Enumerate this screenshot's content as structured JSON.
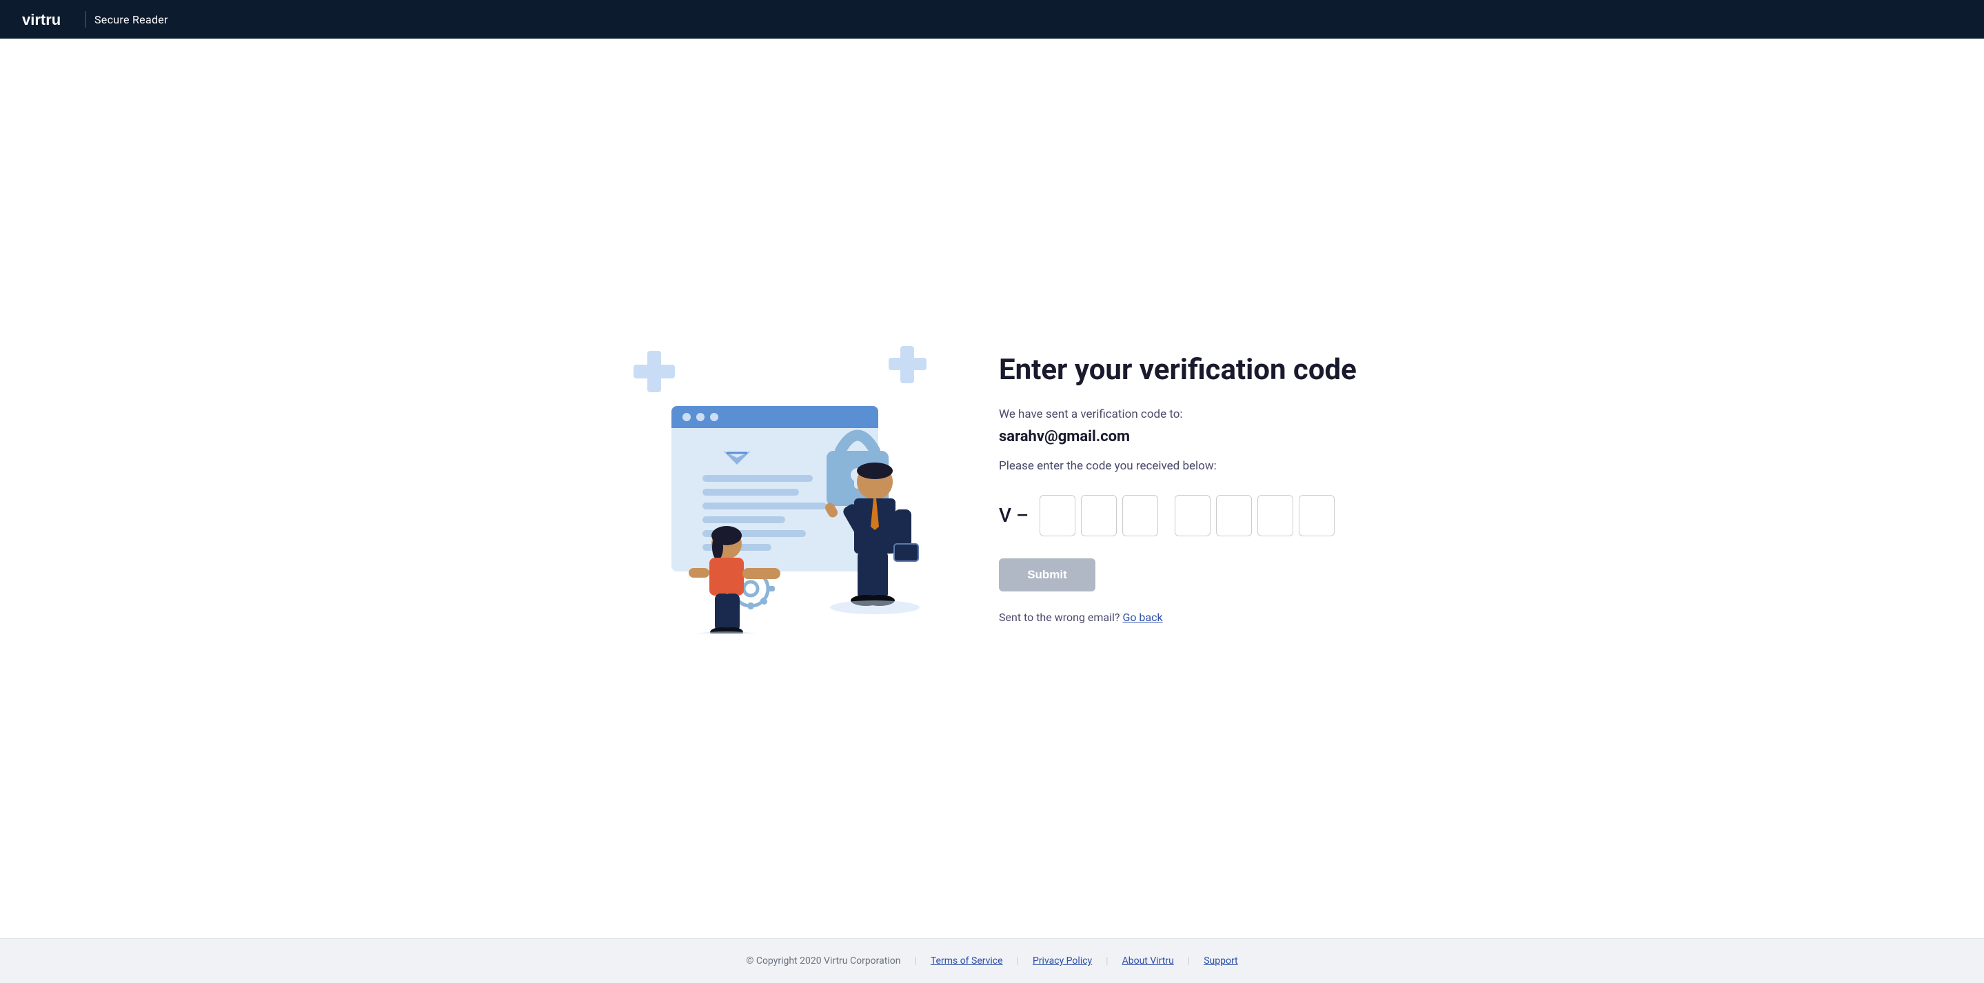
{
  "header": {
    "logo_text": "virtru",
    "divider": "|",
    "title": "Secure Reader"
  },
  "main": {
    "page_title": "Enter your verification code",
    "subtitle": "We have sent a verification code to:",
    "email": "sarahv@gmail.com",
    "instruction": "Please enter the code you received below:",
    "code_prefix": "V –",
    "submit_label": "Submit",
    "wrong_email_text": "Sent to the wrong email?",
    "go_back_label": "Go back"
  },
  "footer": {
    "copyright": "© Copyright 2020 Virtru Corporation",
    "links": [
      {
        "label": "Terms of Service"
      },
      {
        "label": "Privacy Policy"
      },
      {
        "label": "About Virtru"
      },
      {
        "label": "Support"
      }
    ]
  }
}
